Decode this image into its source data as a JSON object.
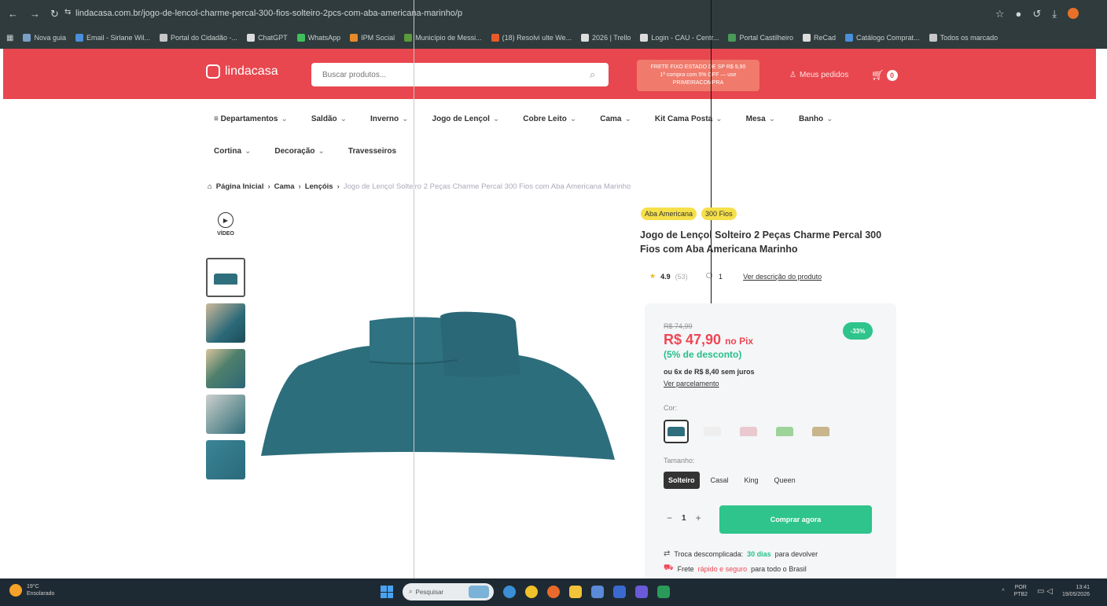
{
  "browser": {
    "url": "lindacasa.com.br/jogo-de-lencol-charme-percal-300-fios-solteiro-2pcs-com-aba-americana-marinho/p",
    "bookmarks": [
      {
        "label": "Nova guia",
        "color": "#7aa0c8"
      },
      {
        "label": "Email - Sirlane Wil...",
        "color": "#4a8fd8"
      },
      {
        "label": "Portal do Cidadão -...",
        "color": "#c7c7c7"
      },
      {
        "label": "ChatGPT",
        "color": "#dcdcdc"
      },
      {
        "label": "WhatsApp",
        "color": "#3fbf5a"
      },
      {
        "label": "IPM Social",
        "color": "#e88a2a"
      },
      {
        "label": "Município de Messi...",
        "color": "#5a9a3a"
      },
      {
        "label": "(18) Resolvi ulte We...",
        "color": "#e85a2a"
      },
      {
        "label": "2026 | Trello",
        "color": "#dcdcdc"
      },
      {
        "label": "Login - CAU - Centr...",
        "color": "#dcdcdc"
      },
      {
        "label": "Portal Castilheiro",
        "color": "#4a9a5a"
      },
      {
        "label": "ReCad",
        "color": "#dcdcdc"
      },
      {
        "label": "Catálogo Comprat...",
        "color": "#4a8fd8"
      },
      {
        "label": "Todos os marcado",
        "color": "#c7c7c7"
      }
    ]
  },
  "header": {
    "logo": "lindacasa",
    "search_placeholder": "Buscar produtos...",
    "promo_lines": [
      "FRETE FIXO ESTADO DE SP R$ 9,90",
      "1ª compra com 5% OFF — use",
      "PRIMEIRACOMPRA"
    ],
    "orders_label": "Meus pedidos",
    "cart_count": "0"
  },
  "categories_row1": [
    "Departamentos",
    "Saldão",
    "Inverno",
    "Jogo de Lençol",
    "Cobre Leito",
    "Cama",
    "Kit Cama Posta",
    "Mesa",
    "Banho"
  ],
  "categories_row2": [
    "Cortina",
    "Decoração",
    "Travesseiros"
  ],
  "breadcrumb": {
    "home": "Página Inicial",
    "level1": "Cama",
    "level2": "Lençóis",
    "current": "Jogo de Lençol Solteiro 2 Peças Charme Percal 300 Fios com Aba Americana Marinho"
  },
  "gallery": {
    "video_label": "VÍDEO"
  },
  "product": {
    "badges": [
      "Aba Americana",
      "300 Fios"
    ],
    "title": "Jogo de Lençol Solteiro 2 Peças Charme Percal 300 Fios com Aba Americana Marinho",
    "rating": "4.9",
    "rating_count": "(53)",
    "questions": "1",
    "description_link": "Ver descrição do produto",
    "old_price": "R$ 74,99",
    "price": "R$ 47,90",
    "price_suffix": "no Pix",
    "pix_discount": "(5% de desconto)",
    "discount_badge": "-33%",
    "installments": "ou 6x de R$ 8,40 sem juros",
    "installments_link": "Ver parcelamento",
    "color_label": "Cor:",
    "swatch_colors": [
      "#2f6e7c",
      "#eeeeee",
      "#e9c9cf",
      "#9ed39a",
      "#c8b58c"
    ],
    "size_label": "Tamanho:",
    "sizes": [
      "Solteiro",
      "Casal",
      "King",
      "Queen"
    ],
    "quantity": "1",
    "buy_label": "Comprar agora",
    "perk1_pre": "Troca descomplicada:",
    "perk1_hl": "30 dias",
    "perk1_post": "para devolver",
    "perk2_pre": "Frete",
    "perk2_hl": "rápido e seguro",
    "perk2_post": "para todo o Brasil"
  },
  "taskbar": {
    "temp": "19°C",
    "weather": "Ensolarado",
    "search": "Pesquisar",
    "lang1": "POR",
    "lang2": "PTB2",
    "time": "13:41",
    "date": "19/05/2026"
  }
}
